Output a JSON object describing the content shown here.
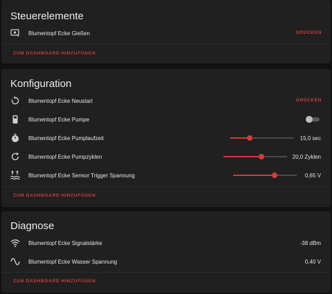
{
  "steuerelemente": {
    "title": "Steuerelemente",
    "rows": [
      {
        "icon": "watering-touch-icon",
        "label": "Blumentopf Ecke Gießen",
        "action": "DRÜCKEN"
      }
    ],
    "dashboard_link": "ZUM DASHBOARD HINZUFÜGEN"
  },
  "konfiguration": {
    "title": "Konfiguration",
    "rows": [
      {
        "icon": "restart-icon",
        "label": "Blumentopf Ecke Neustart",
        "action": "DRÜCKEN"
      },
      {
        "icon": "pump-icon",
        "label": "Blumentopf Ecke Pumpe",
        "toggle_on": false
      },
      {
        "icon": "timer-icon",
        "label": "Blumentopf Ecke Pumplaufzeit",
        "value": "15,0 sec",
        "slider_level": 0.3
      },
      {
        "icon": "repeat-icon",
        "label": "Blumentopf Ecke Pumpzyklen",
        "value": "20,0 Zyklen",
        "slider_level": 0.6
      },
      {
        "icon": "water-level-icon",
        "label": "Blumentopf Ecke Sensor Trigger Spannung",
        "value": "0,65 V",
        "slider_level": 0.65
      }
    ],
    "dashboard_link": "ZUM DASHBOARD HINZUFÜGEN"
  },
  "diagnose": {
    "title": "Diagnose",
    "rows": [
      {
        "icon": "wifi-icon",
        "label": "Blumentopf Ecke Signalstärke",
        "value": "-38 dBm"
      },
      {
        "icon": "sine-wave-icon",
        "label": "Blumentopf Ecke Wasser Spannung",
        "value": "0,40 V"
      }
    ],
    "dashboard_link": "ZUM DASHBOARD HINZUFÜGEN"
  },
  "colors": {
    "accent": "#d73a3a",
    "card": "#202020",
    "background": "#111111"
  }
}
